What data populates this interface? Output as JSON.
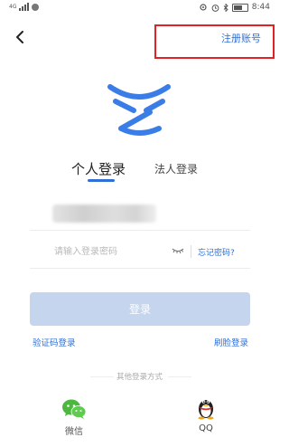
{
  "status_bar": {
    "network": "4G",
    "time": "8:44"
  },
  "header": {
    "back_icon": "chevron-left-icon",
    "register_label": "注册账号"
  },
  "tabs": {
    "personal": "个人登录",
    "corporate": "法人登录",
    "active": "personal"
  },
  "form": {
    "account_value_blurred": true,
    "password_placeholder": "请输入登录密码",
    "eye_icon": "eye-closed-icon",
    "forgot_label": "忘记密码?",
    "login_label": "登录",
    "sms_login_label": "验证码登录",
    "face_login_label": "刷脸登录"
  },
  "other_login": {
    "title": "其他登录方式",
    "wechat_label": "微信",
    "qq_label": "QQ"
  },
  "colors": {
    "accent": "#2f6fd6",
    "login_button": "#c5d5ee",
    "highlight_box": "#e02222"
  }
}
